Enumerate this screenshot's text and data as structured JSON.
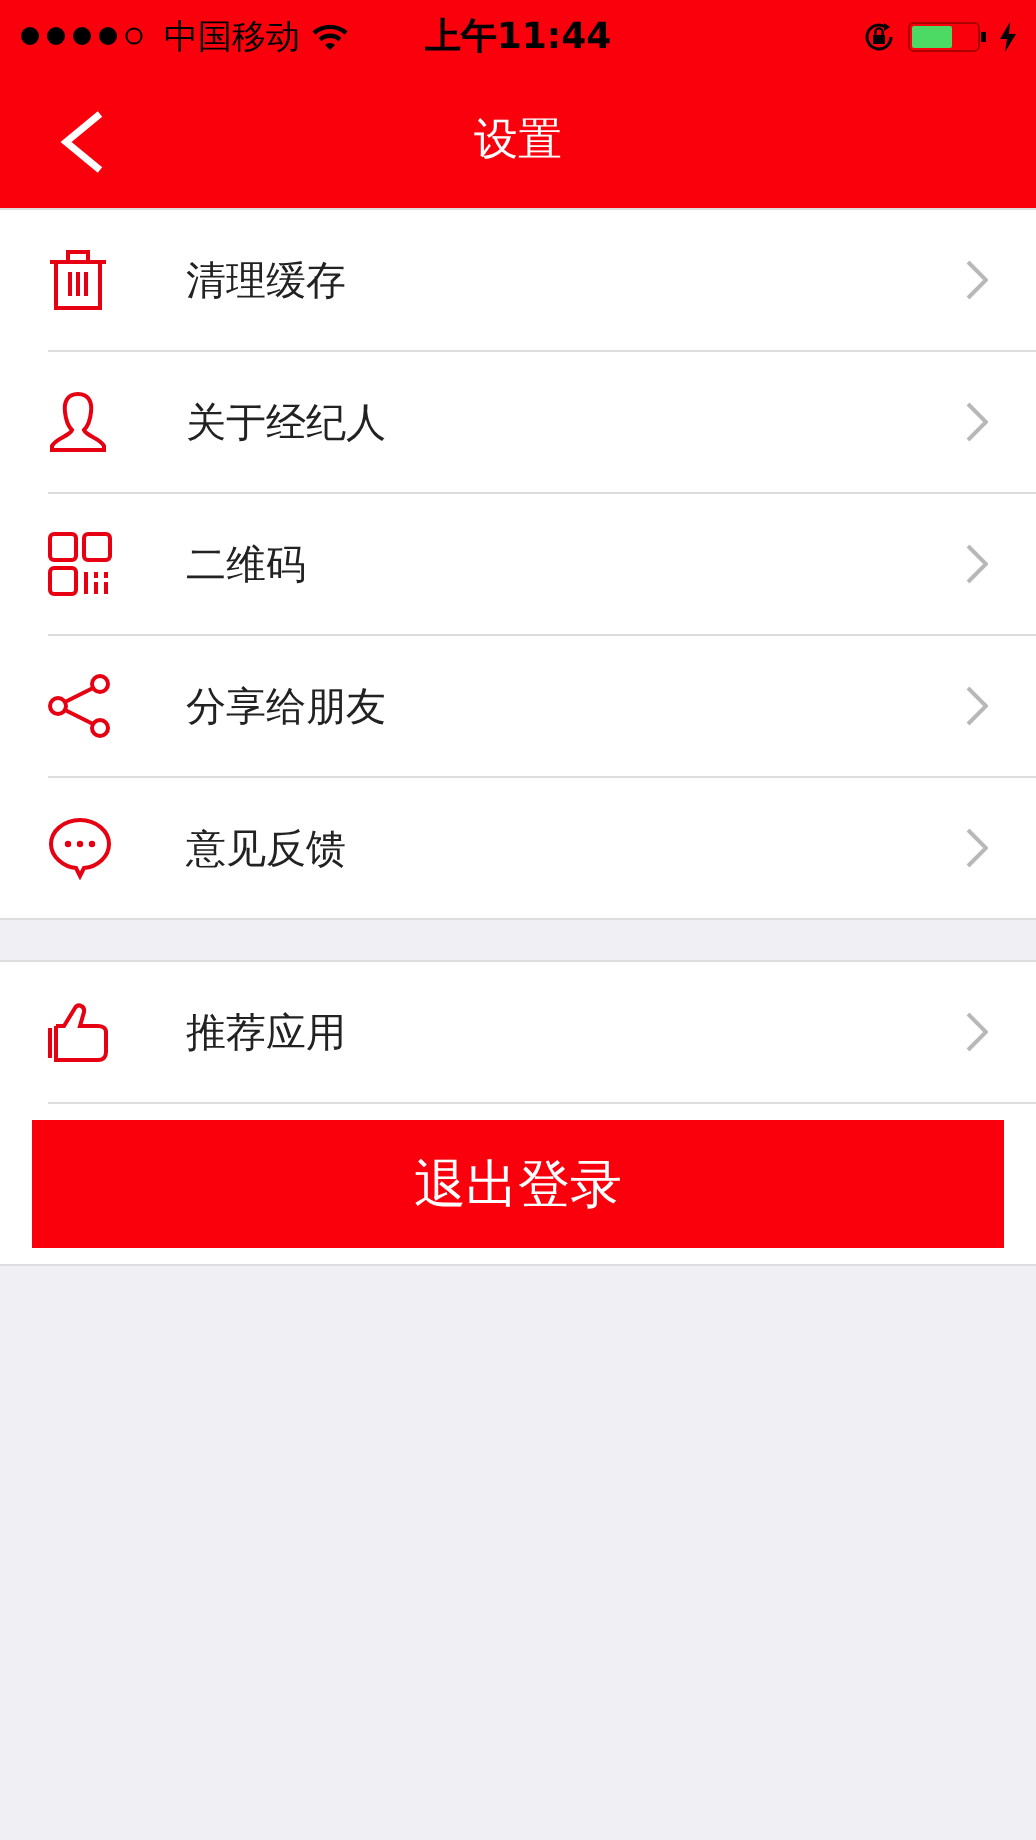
{
  "status_bar": {
    "carrier": "中国移动",
    "time": "上午11:44"
  },
  "nav_bar": {
    "title": "设置"
  },
  "groups": [
    {
      "items": [
        {
          "kind": "trash",
          "label": "清理缓存"
        },
        {
          "kind": "person",
          "label": "关于经纪人"
        },
        {
          "kind": "qr",
          "label": "二维码"
        },
        {
          "kind": "share",
          "label": "分享给朋友"
        },
        {
          "kind": "chat",
          "label": "意见反馈"
        }
      ]
    },
    {
      "items": [
        {
          "kind": "thumb",
          "label": "推荐应用"
        }
      ]
    }
  ],
  "logout_button": "退出登录"
}
